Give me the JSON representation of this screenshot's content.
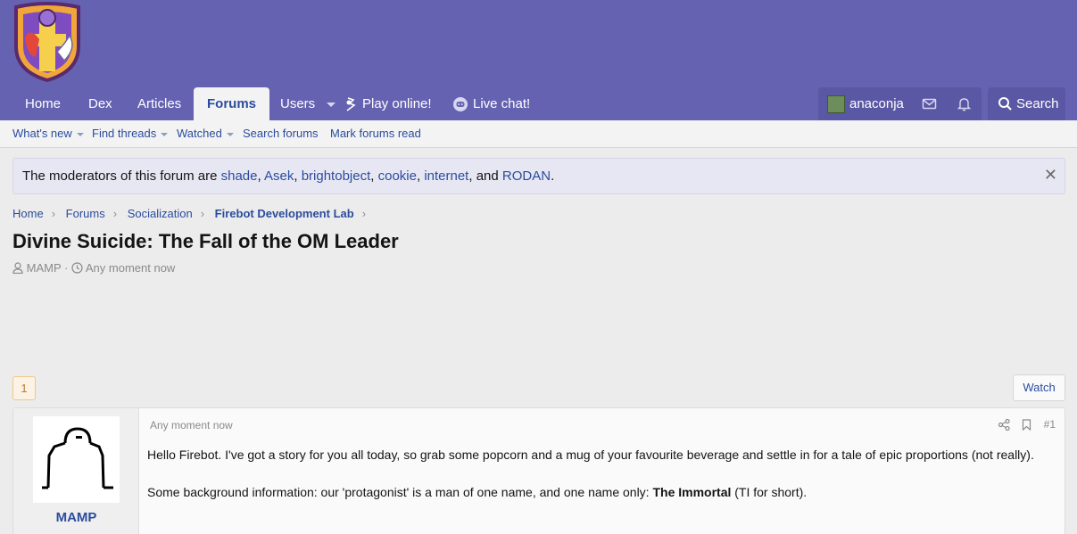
{
  "colors": {
    "header": "#6562b1",
    "link": "#2b4c9e",
    "background": "#ececec"
  },
  "nav": {
    "home": "Home",
    "dex": "Dex",
    "articles": "Articles",
    "forums": "Forums",
    "users": "Users",
    "play": "Play online!",
    "chat": "Live chat!",
    "username": "anaconja",
    "search": "Search"
  },
  "subnav": {
    "whats_new": "What's new",
    "find_threads": "Find threads",
    "watched": "Watched",
    "search_forums": "Search forums",
    "mark_read": "Mark forums read"
  },
  "notice": {
    "prefix": "The moderators of this forum are",
    "mods": [
      "shade",
      "Asek",
      "brightobject",
      "cookie",
      "internet",
      "RODAN"
    ],
    "sep1": ",",
    "and": "and",
    "end": "."
  },
  "breadcrumb": [
    "Home",
    "Forums",
    "Socialization",
    "Firebot Development Lab"
  ],
  "thread": {
    "title": "Divine Suicide: The Fall of the OM Leader",
    "author": "MAMP",
    "time": "Any moment now",
    "meta_sep": "·"
  },
  "pagination": {
    "current_page": "1",
    "watch_label": "Watch"
  },
  "post": {
    "username": "MAMP",
    "time": "Any moment now",
    "number": "#1",
    "para1": "Hello Firebot. I've got a story for you all today, so grab some popcorn and a mug of your favourite beverage and settle in for a tale of epic proportions (not really).",
    "para2_start": "Some background information: our 'protagonist' is a man of one name, and one name only: ",
    "para2_bold": "The Immortal",
    "para2_end": " (TI for short)."
  }
}
